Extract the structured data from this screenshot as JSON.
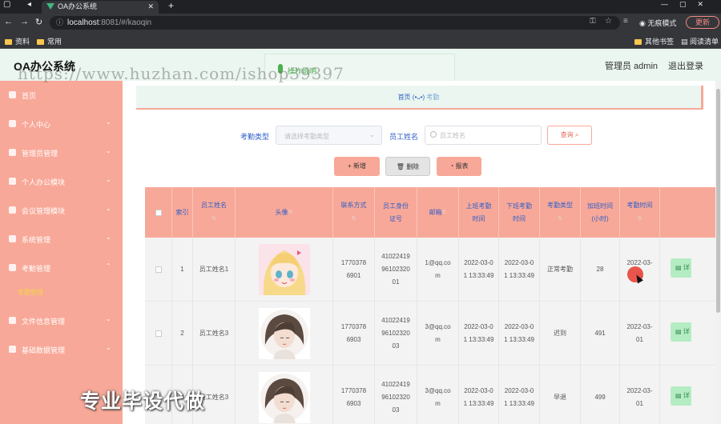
{
  "browser": {
    "tab_title": "OA办公系统",
    "url_host": "localhost",
    "url_path": ":8081/#/kaoqin",
    "incognito_label": "无痕模式",
    "update_label": "更新",
    "bookmarks": [
      "资料",
      "常用"
    ],
    "bookmarks_right": [
      "其他书签",
      "阅读清单"
    ],
    "icons": [
      "back-icon",
      "forward-icon",
      "reload-icon",
      "lock-icon",
      "key-icon",
      "star-icon",
      "incognito-icon"
    ]
  },
  "header": {
    "brand": "OA办公系统",
    "user": "管理员 admin",
    "logout": "退出登录",
    "float_tab": "操作说明"
  },
  "watermarks": {
    "url_mark": "https://www.huzhan.com/ishop39397",
    "slogan": "专业毕设代做"
  },
  "sidebar": {
    "items": [
      {
        "label": "首页",
        "icon": "home-icon",
        "arrow": ""
      },
      {
        "label": "个人中心",
        "icon": "user-icon",
        "arrow": "⌄"
      },
      {
        "label": "管理员管理",
        "icon": "admin-icon",
        "arrow": "⌄"
      },
      {
        "label": "个人办公模块",
        "icon": "briefcase-icon",
        "arrow": "⌄"
      },
      {
        "label": "会议管理模块",
        "icon": "meeting-icon",
        "arrow": "⌄"
      },
      {
        "label": "系统管理",
        "icon": "settings-icon",
        "arrow": "⌄"
      },
      {
        "label": "考勤管理",
        "icon": "attendance-icon",
        "arrow": "⌃"
      },
      {
        "label": "文件信息管理",
        "icon": "file-icon",
        "arrow": "⌄"
      },
      {
        "label": "基础数据管理",
        "icon": "data-icon",
        "arrow": "⌄"
      }
    ],
    "active_submenu": "考勤管理"
  },
  "breadcrumb": {
    "home": "首页",
    "emoticon": "(•ᴗ•)",
    "current": "考勤"
  },
  "search": {
    "type_label": "考勤类型",
    "type_placeholder": "请选择考勤类型",
    "name_label": "员工姓名",
    "name_placeholder": "员工姓名",
    "query_button": "查询"
  },
  "actions": {
    "add": "+ 新增",
    "delete": "删除",
    "report": "报表"
  },
  "table": {
    "headers": [
      "索引",
      "员工姓名",
      "头像",
      "联系方式",
      "员工身份证号",
      "邮箱",
      "上班考勤时间",
      "下班考勤时间",
      "考勤类型",
      "加班时间(小时)",
      "考勤时间"
    ],
    "rows": [
      {
        "index": "1",
        "name": "员工姓名1",
        "phone": "17703786901",
        "idcard": "410224199610232001",
        "email": "1@qq.com",
        "checkin": "2022-03-01 13:33:49",
        "checkout": "2022-03-01 13:33:49",
        "type": "正常考勤",
        "overtime": "28",
        "date": "2022-03-01",
        "avatar": "anime-avatar"
      },
      {
        "index": "2",
        "name": "员工姓名3",
        "phone": "17703786903",
        "idcard": "410224199610232003",
        "email": "3@qq.com",
        "checkin": "2022-03-01 13:33:49",
        "checkout": "2022-03-01 13:33:49",
        "type": "迟到",
        "overtime": "491",
        "date": "2022-03-01",
        "avatar": "portrait-avatar"
      },
      {
        "index": "3",
        "name": "员工姓名3",
        "phone": "17703786903",
        "idcard": "410224199610232003",
        "email": "3@qq.com",
        "checkin": "2022-03-01 13:33:49",
        "checkout": "2022-03-01 13:33:49",
        "type": "早退",
        "overtime": "499",
        "date": "2022-03-01",
        "avatar": "portrait-avatar"
      }
    ],
    "detail_button": "详"
  },
  "colors": {
    "accent": "#f8a898",
    "header_bg": "#eaf6ef",
    "link_blue": "#2e5ec9",
    "success_btn": "#b6ecc3"
  }
}
